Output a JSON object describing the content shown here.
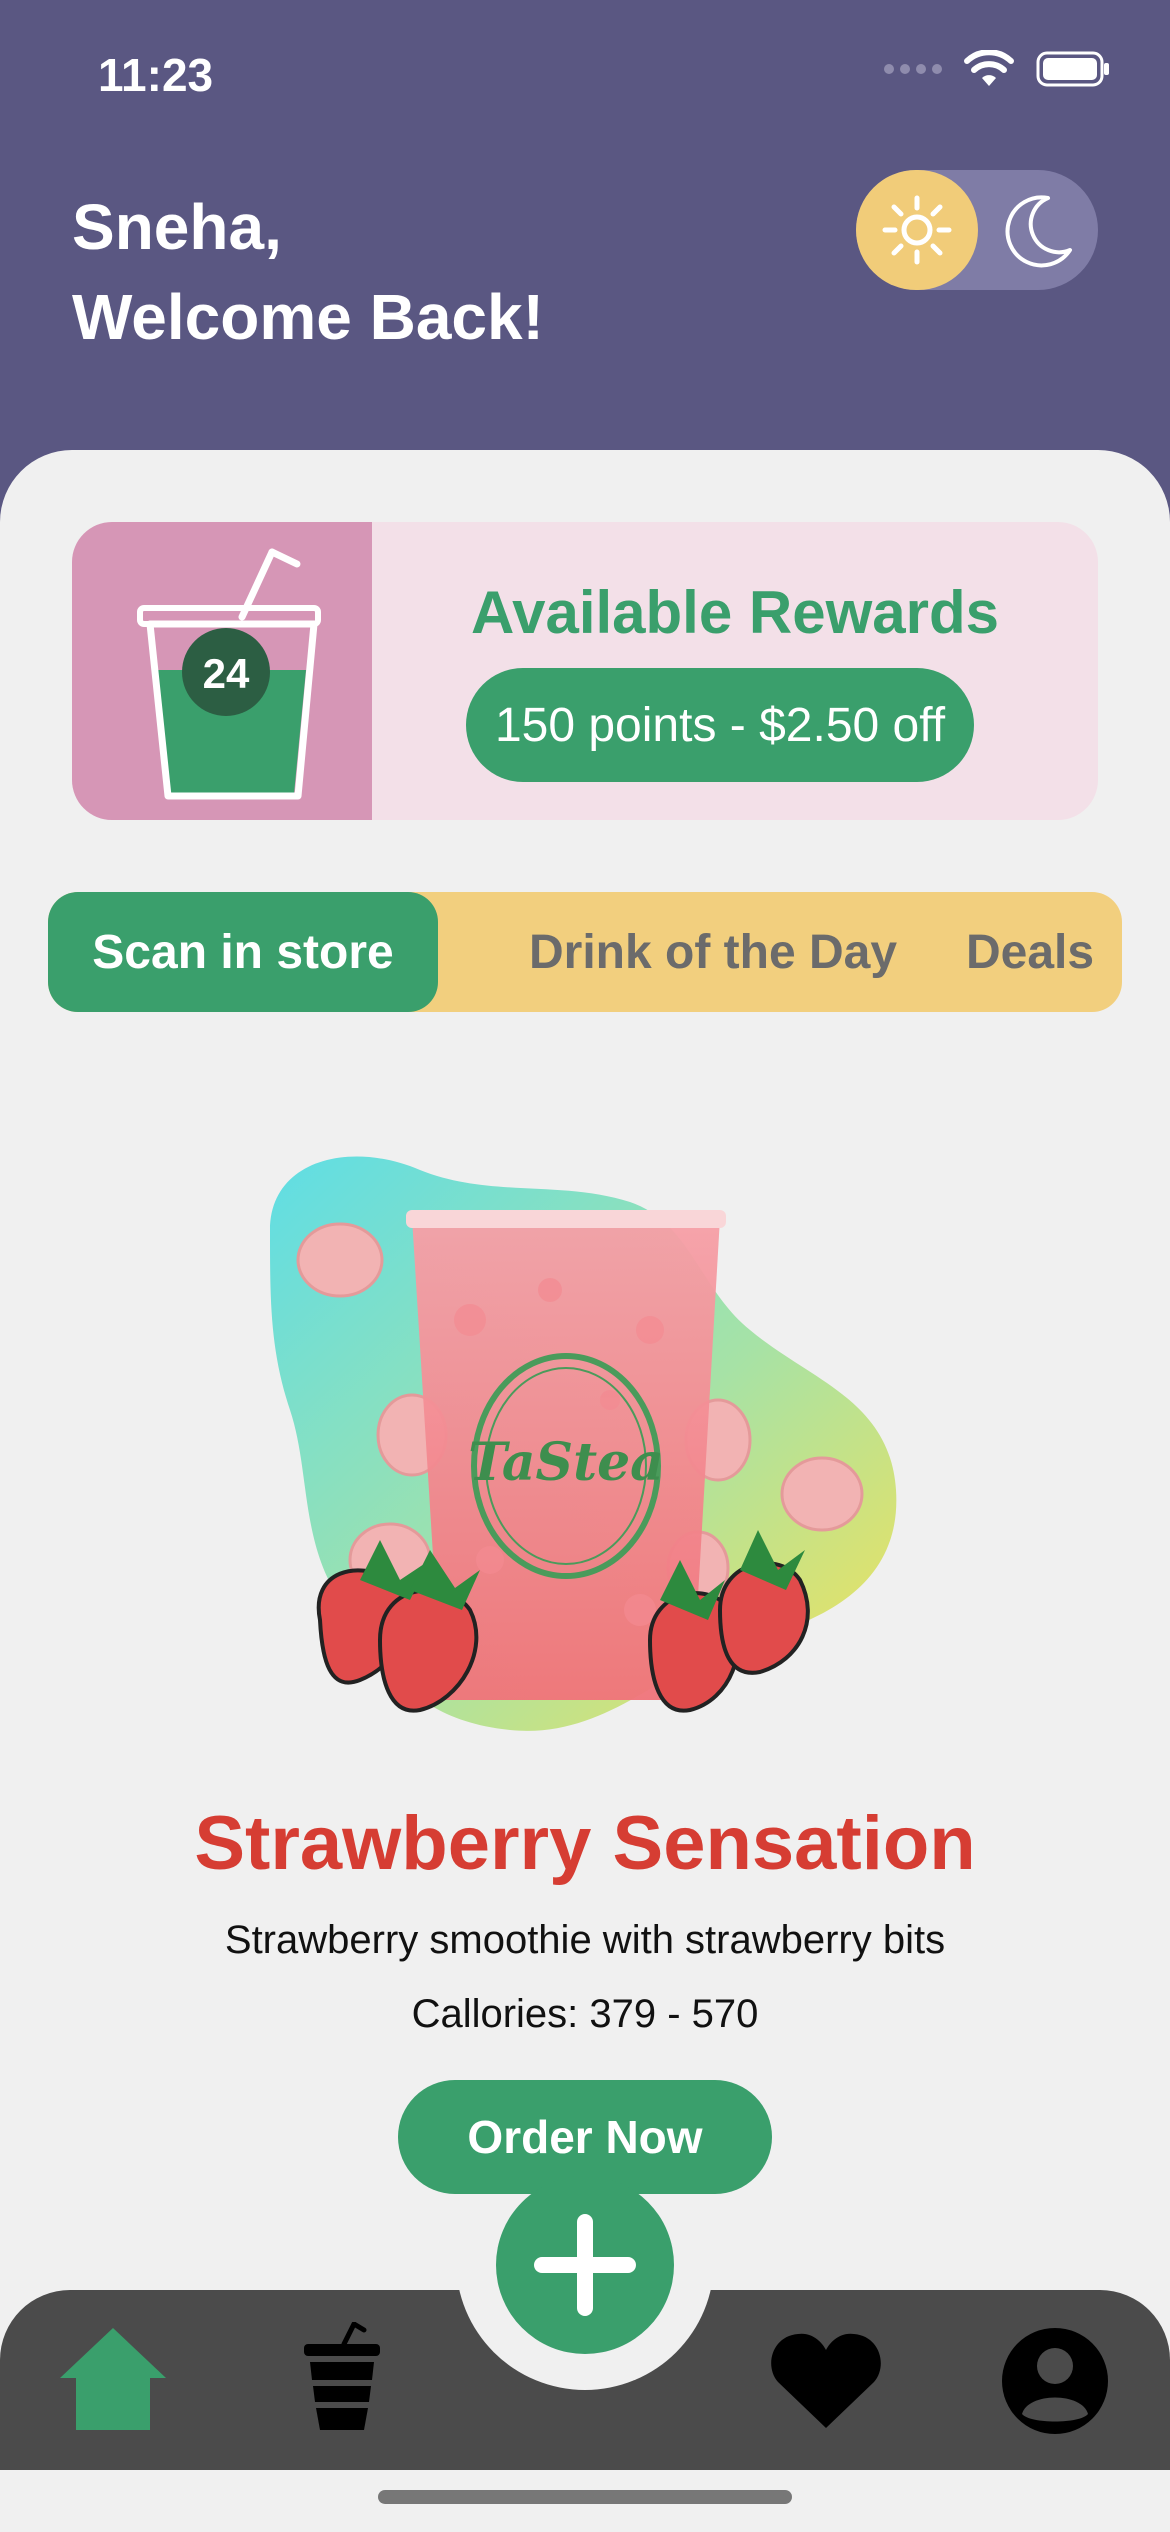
{
  "status_bar": {
    "time": "11:23"
  },
  "header": {
    "greeting_line1": "Sneha,",
    "greeting_line2": "Welcome Back!"
  },
  "theme_toggle": {
    "mode": "light",
    "light_icon": "sun-icon",
    "dark_icon": "moon-icon"
  },
  "rewards": {
    "cup_count": "24",
    "title": "Available Rewards",
    "points_label": "150 points - $2.50 off"
  },
  "tabs": [
    {
      "label": "Scan in store",
      "active": true
    },
    {
      "label": "Drink of the Day",
      "active": false
    },
    {
      "label": "Deals",
      "active": false
    }
  ],
  "featured": {
    "name": "Strawberry Sensation",
    "description": "Strawberry smoothie with strawberry bits",
    "calories": "Callories: 379 - 570",
    "cup_logo": "TaStea",
    "order_label": "Order Now"
  },
  "tabbar": {
    "items": [
      "home-icon",
      "drink-icon",
      "add-icon",
      "heart-icon",
      "profile-icon"
    ],
    "active": "home-icon"
  },
  "colors": {
    "header": "#5a5782",
    "accent_green": "#3a9f6c",
    "title_red": "#d63d33",
    "tab_yellow": "#f2cf7e",
    "reward_pink": "#d696b6",
    "tabbar": "#4b4b4b"
  }
}
